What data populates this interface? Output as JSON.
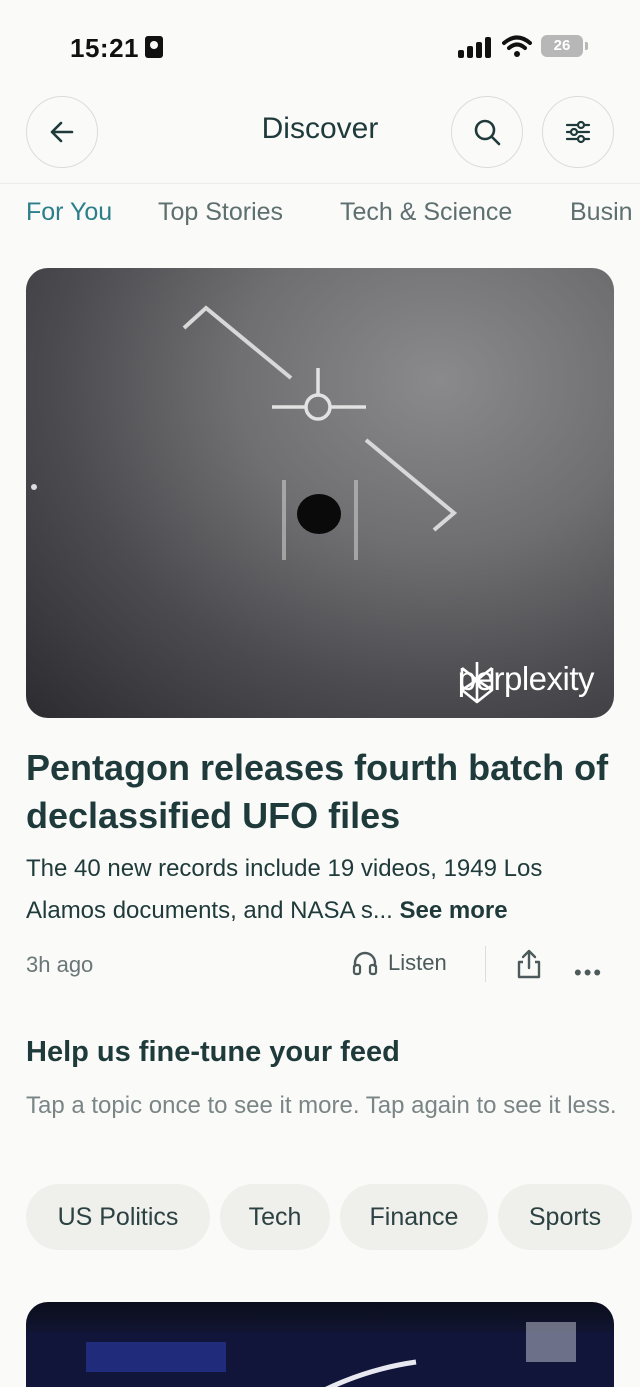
{
  "status_bar": {
    "time": "15:21",
    "battery": "26"
  },
  "header": {
    "title": "Discover",
    "back_icon": "arrow-left-icon",
    "search_icon": "search-icon",
    "filter_icon": "sliders-icon"
  },
  "tabs": [
    {
      "label": "For You",
      "active": true
    },
    {
      "label": "Top Stories",
      "active": false
    },
    {
      "label": "Tech & Science",
      "active": false
    },
    {
      "label": "Busin",
      "active": false
    }
  ],
  "article": {
    "brand": "perplexity",
    "headline": "Pentagon releases fourth batch of declassified UFO files",
    "summary": "The 40 new records include 19 videos, 1949 Los Alamos documents, and NASA s...",
    "see_more": "See more",
    "time_ago": "3h ago",
    "listen_label": "Listen",
    "more_label": "•••"
  },
  "feed_tune": {
    "title": "Help us fine-tune your feed",
    "subtitle": "Tap a topic once to see it more. Tap again to see it less.",
    "topics": [
      "US Politics",
      "Tech",
      "Finance",
      "Sports"
    ]
  },
  "colors": {
    "accent": "#2a7f8a",
    "text": "#1f3a3a",
    "background": "#fafaf8"
  }
}
